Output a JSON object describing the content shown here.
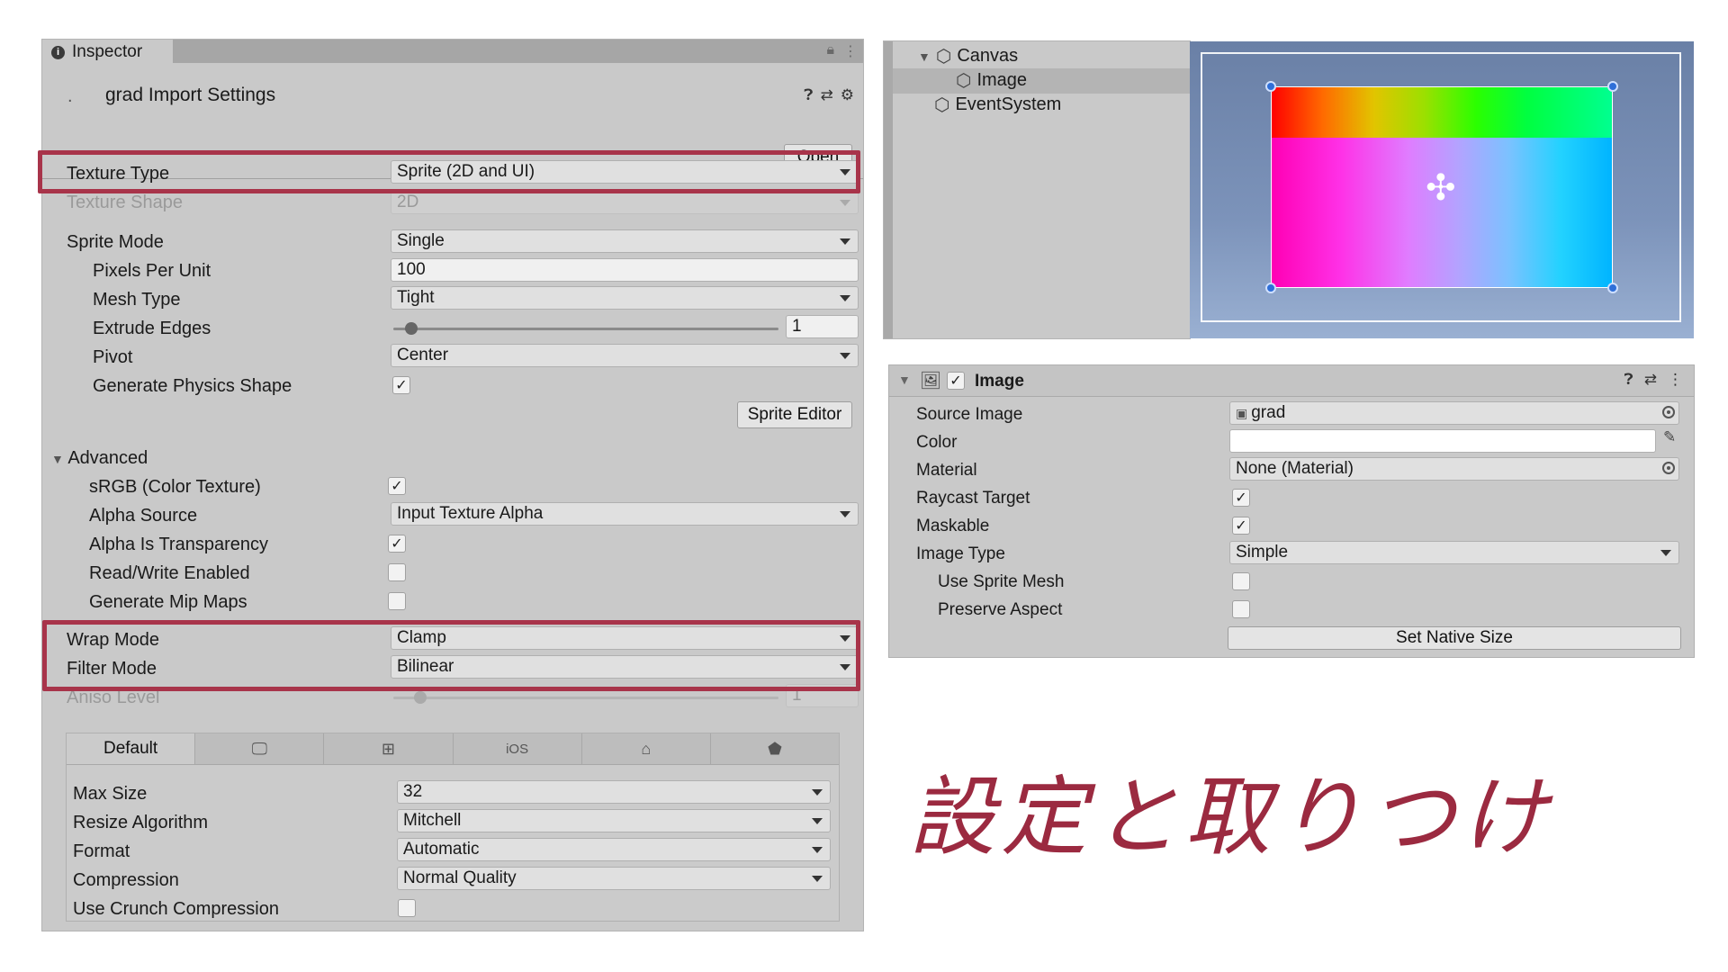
{
  "inspector": {
    "tab_label": "Inspector",
    "asset_title": "grad Import Settings",
    "asset_dot": ".",
    "open_label": "Open",
    "rows": {
      "texture_type_label": "Texture Type",
      "texture_type_value": "Sprite (2D and UI)",
      "texture_shape_label": "Texture Shape",
      "texture_shape_value": "2D",
      "sprite_mode_label": "Sprite Mode",
      "sprite_mode_value": "Single",
      "ppu_label": "Pixels Per Unit",
      "ppu_value": "100",
      "mesh_type_label": "Mesh Type",
      "mesh_type_value": "Tight",
      "extrude_label": "Extrude Edges",
      "extrude_value": "1",
      "pivot_label": "Pivot",
      "pivot_value": "Center",
      "physics_label": "Generate Physics Shape",
      "sprite_editor_label": "Sprite Editor",
      "advanced_label": "Advanced",
      "srgb_label": "sRGB (Color Texture)",
      "alpha_source_label": "Alpha Source",
      "alpha_source_value": "Input Texture Alpha",
      "alpha_transp_label": "Alpha Is Transparency",
      "rw_label": "Read/Write Enabled",
      "mipmaps_label": "Generate Mip Maps",
      "wrap_label": "Wrap Mode",
      "wrap_value": "Clamp",
      "filter_label": "Filter Mode",
      "filter_value": "Bilinear",
      "aniso_label": "Aniso Level",
      "aniso_value": "1"
    },
    "checks": {
      "physics": true,
      "srgb": true,
      "alpha_transp": true,
      "rw": false,
      "mipmaps": false,
      "crunch": false
    },
    "platform": {
      "tabs": [
        "Default",
        "",
        "",
        "iOS",
        "",
        ""
      ],
      "max_size_label": "Max Size",
      "max_size_value": "32",
      "resize_label": "Resize Algorithm",
      "resize_value": "Mitchell",
      "format_label": "Format",
      "format_value": "Automatic",
      "compression_label": "Compression",
      "compression_value": "Normal Quality",
      "crunch_label": "Use Crunch Compression"
    }
  },
  "hierarchy": {
    "items": [
      "Canvas",
      "Image",
      "EventSystem"
    ]
  },
  "image_component": {
    "title": "Image",
    "source_image_label": "Source Image",
    "source_image_value": "grad",
    "color_label": "Color",
    "material_label": "Material",
    "material_value": "None (Material)",
    "raycast_label": "Raycast Target",
    "maskable_label": "Maskable",
    "image_type_label": "Image Type",
    "image_type_value": "Simple",
    "use_sprite_mesh_label": "Use Sprite Mesh",
    "preserve_aspect_label": "Preserve Aspect",
    "set_native_label": "Set Native Size"
  },
  "caption": "設定と取りつけ",
  "colors": {
    "highlight": "#a8344a",
    "panel": "#c9c9c9",
    "caption": "#9b2a40"
  }
}
